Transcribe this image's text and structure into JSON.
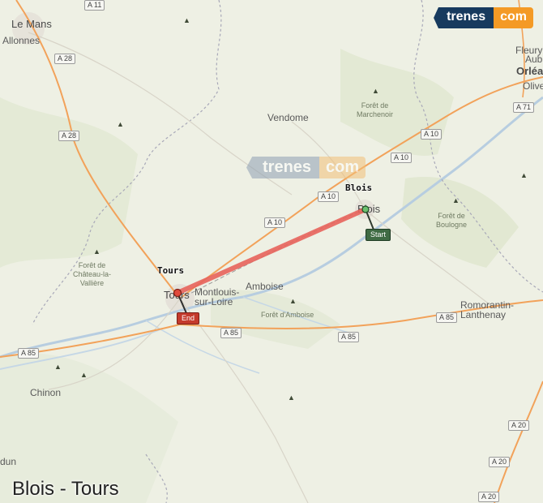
{
  "logo": {
    "part1": "trenes",
    "part2": "com"
  },
  "title": "Blois - Tours",
  "route": {
    "origin_label": "Blois",
    "destination_label": "Tours",
    "start_marker": "Start",
    "end_marker": "End",
    "line_color": "#e8645c"
  },
  "places": {
    "le_mans": "Le Mans",
    "allonnes": "Allonnes",
    "vendome": "Vendome",
    "fleury": "Fleury",
    "aub": "Aub",
    "orlea": "Orléa",
    "olive": "Olive",
    "blois_map": "Blois",
    "tours_map": "Tours",
    "montlouis": "Montlouis-\nsur-Loire",
    "amboise": "Amboise",
    "romorantin": "Romorantin-\nLanthenay",
    "chinon": "Chinon",
    "loudun": "dun"
  },
  "forests": {
    "marchenoir": "Forêt de\nMarchenoir",
    "boulogne": "Forêt de\nBoulogne",
    "chateau": "Forêt de\nChâteau-la-\nVallière",
    "amboise": "Forêt d'Amboise"
  },
  "roads": {
    "a11": "A 11",
    "a28_1": "A 28",
    "a28_2": "A 28",
    "a10_1": "A 10",
    "a10_2": "A 10",
    "a10_3": "A 10",
    "a10_4": "A 10",
    "a71": "A 71",
    "a85_1": "A 85",
    "a85_2": "A 85",
    "a85_3": "A 85",
    "a85_4": "A 85",
    "a20_1": "A 20",
    "a20_2": "A 20",
    "a20_3": "A 20"
  },
  "colors": {
    "land": "#eef0e4",
    "river": "#b7cde0",
    "motorway": "#f2a25a",
    "route": "#e8645c",
    "logo_blue": "#173a5e",
    "logo_orange": "#f49a25"
  }
}
